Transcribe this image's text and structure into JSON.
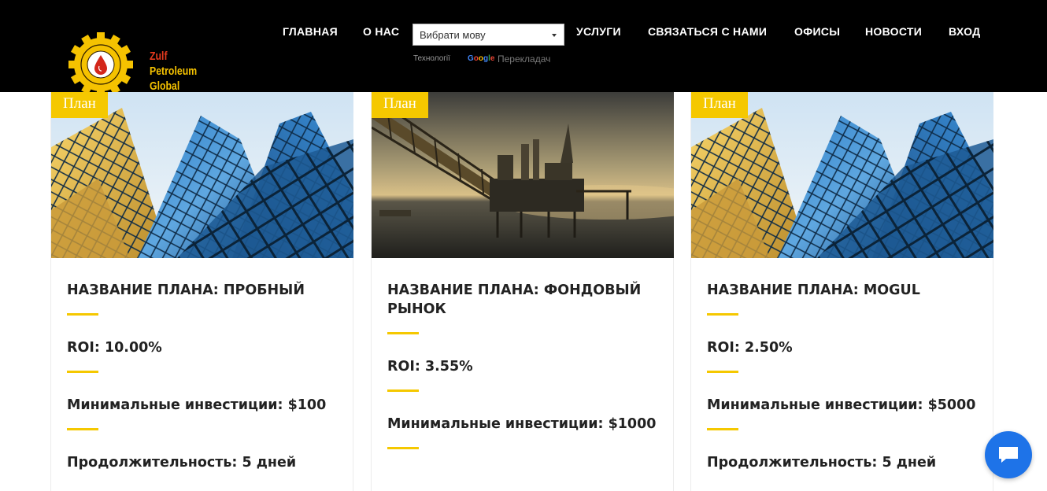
{
  "header": {
    "logo": {
      "text_line1_part1": "Zulf",
      "text_line1_part2": " Petroleum",
      "text_line2": "Global",
      "emblem_text": "ZULF PETROLEUM GLOBAL"
    },
    "nav": {
      "home": "ГЛАВНАЯ",
      "about": "О НАС",
      "services": "УСЛУГИ",
      "contact": "СВЯЗАТЬСЯ С НАМИ",
      "offices": "ОФИСЫ",
      "news": "НОВОСТИ",
      "login": "ВХОД"
    },
    "translate": {
      "select_value": "Вибрати мову",
      "powered_by": "Технології",
      "google": "Google",
      "translate_label": "Перекладач"
    }
  },
  "cards": [
    {
      "badge": "План",
      "image": "skyscrapers",
      "title": "НАЗВАНИЕ ПЛАНА: ПРОБНЫЙ",
      "roi": "ROI: 10.00%",
      "min_investment": "Минимальные инвестиции: $100",
      "duration": "Продолжительность: 5 дней"
    },
    {
      "badge": "План",
      "image": "oil-platform",
      "title": "НАЗВАНИЕ ПЛАНА: ФОНДОВЫЙ РЫНОК",
      "roi": "ROI: 3.55%",
      "min_investment": "Минимальные инвестиции: $1000",
      "duration": ""
    },
    {
      "badge": "План",
      "image": "skyscrapers",
      "title": "НАЗВАНИЕ ПЛАНА: MOGUL",
      "roi": "ROI: 2.50%",
      "min_investment": "Минимальные инвестиции: $5000",
      "duration": "Продолжительность: 5 дней"
    }
  ],
  "chat_widget": {
    "icon": "chat-bubble-icon"
  },
  "colors": {
    "accent": "#f5c800",
    "header_bg": "#000000",
    "chat_bg": "#1e73e8",
    "text_dark": "#222222"
  }
}
